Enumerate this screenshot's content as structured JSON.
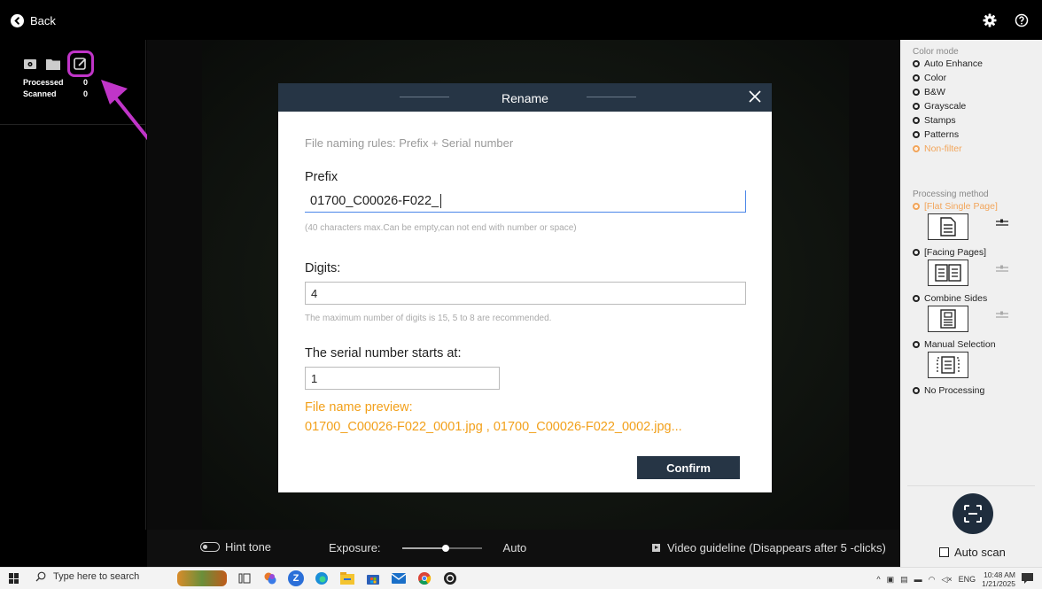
{
  "topbar": {
    "back_label": "Back"
  },
  "left_panel": {
    "processed_label": "Processed",
    "processed_count": "0",
    "scanned_label": "Scanned",
    "scanned_count": "0"
  },
  "modal": {
    "title": "Rename",
    "rule_text": "File naming rules: Prefix + Serial number",
    "prefix_label": "Prefix",
    "prefix_value": "01700_C00026-F022_",
    "prefix_hint": "(40 characters max.Can be empty,can not end with number or space)",
    "digits_label": "Digits:",
    "digits_value": "4",
    "digits_hint": "The maximum number of digits is 15, 5 to 8 are recommended.",
    "serial_label": "The serial number starts at:",
    "serial_value": "1",
    "preview_label": "File name preview:",
    "preview_value": "01700_C00026-F022_0001.jpg , 01700_C00026-F022_0002.jpg...",
    "confirm_label": "Confirm"
  },
  "bottombar": {
    "hint_tone_label": "Hint tone",
    "exposure_label": "Exposure:",
    "exposure_level": 0.55,
    "exposure_mode": "Auto",
    "guideline_label": "Video guideline  (Disappears after 5 -clicks)"
  },
  "right_panel": {
    "color_mode_title": "Color mode",
    "color_modes": [
      "Auto Enhance",
      "Color",
      "B&W",
      "Grayscale",
      "Stamps",
      "Patterns",
      "Non-filter"
    ],
    "color_mode_selected": "Non-filter",
    "processing_title": "Processing method",
    "processing_methods": [
      "[Flat Single Page]",
      "[Facing Pages]",
      "Combine Sides",
      "Manual Selection",
      "No Processing"
    ],
    "processing_selected": "[Flat Single Page]",
    "auto_scan_label": "Auto scan"
  },
  "taskbar": {
    "search_placeholder": "Type here to search",
    "lang": "ENG",
    "time": "10:48 AM",
    "date": "1/21/2025"
  },
  "colors": {
    "accent_orange": "#f2a01a",
    "highlight_magenta": "#c035c8",
    "modal_header": "#263545"
  }
}
